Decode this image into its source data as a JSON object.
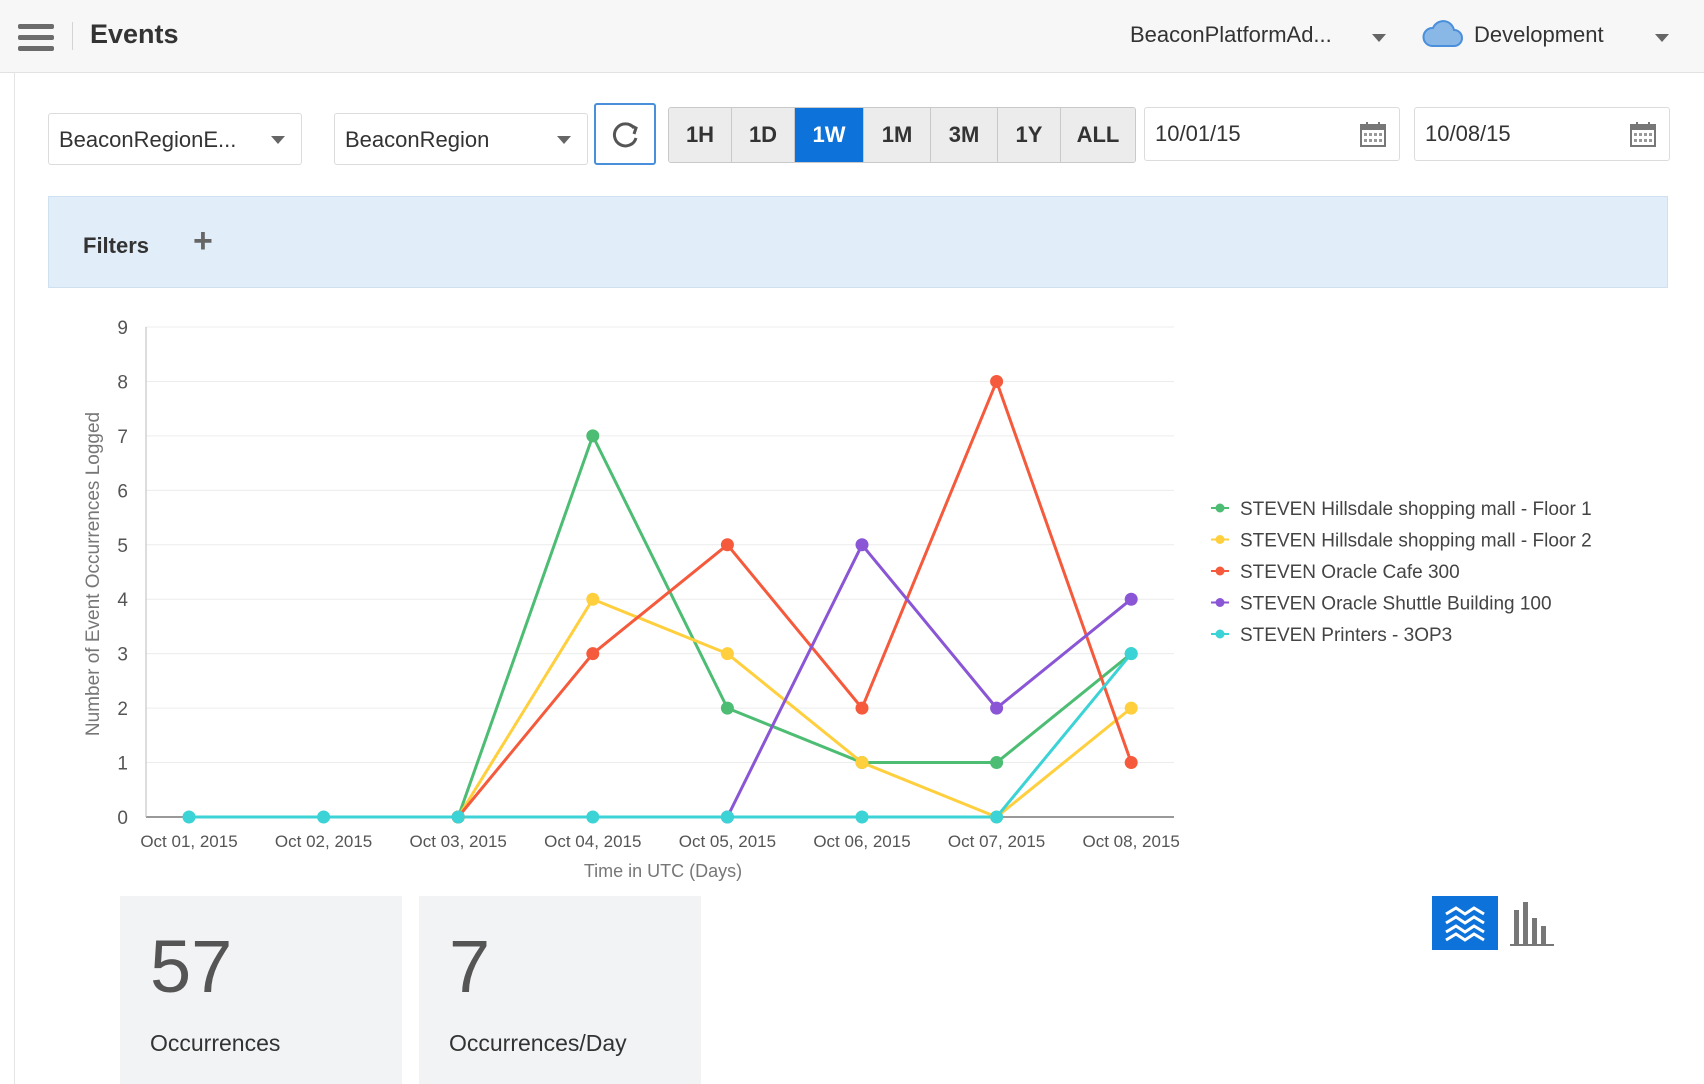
{
  "header": {
    "title": "Events",
    "user_account": "BeaconPlatformAd...",
    "environment": "Development",
    "menu_icon": "hamburger-menu-icon",
    "environment_icon": "cloud-icon"
  },
  "toolbar": {
    "event_select": "BeaconRegionE...",
    "region_select": "BeaconRegion",
    "refresh_icon": "refresh-icon",
    "ranges": [
      "1H",
      "1D",
      "1W",
      "1M",
      "3M",
      "1Y",
      "ALL"
    ],
    "active_range": "1W",
    "start_date": "10/01/15",
    "end_date": "10/08/15",
    "calendar_icon": "calendar-icon",
    "accent_color": "#0d72d9"
  },
  "filters": {
    "label": "Filters",
    "add_symbol": "+"
  },
  "chart_data": {
    "type": "line",
    "xlabel": "Time in UTC (Days)",
    "ylabel": "Number of Event Occurrences Logged",
    "ylim": [
      0,
      9
    ],
    "yticks": [
      0,
      1,
      2,
      3,
      4,
      5,
      6,
      7,
      8,
      9
    ],
    "grid": true,
    "legend_position": "right",
    "categories": [
      "Oct 01, 2015",
      "Oct 02, 2015",
      "Oct 03, 2015",
      "Oct 04, 2015",
      "Oct 05, 2015",
      "Oct 06, 2015",
      "Oct 07, 2015",
      "Oct 08, 2015"
    ],
    "series": [
      {
        "name": "STEVEN Hillsdale shopping mall - Floor 1",
        "color": "#4dbd74",
        "values": [
          null,
          null,
          0,
          7,
          2,
          1,
          1,
          3
        ]
      },
      {
        "name": "STEVEN Hillsdale shopping mall - Floor 2",
        "color": "#ffcf3d",
        "values": [
          null,
          null,
          0,
          4,
          3,
          1,
          0,
          2
        ]
      },
      {
        "name": "STEVEN Oracle Cafe 300",
        "color": "#f55a3c",
        "values": [
          null,
          null,
          0,
          3,
          5,
          2,
          8,
          1
        ]
      },
      {
        "name": "STEVEN Oracle Shuttle Building 100",
        "color": "#8a56d6",
        "values": [
          null,
          null,
          null,
          null,
          0,
          5,
          2,
          4
        ]
      },
      {
        "name": "STEVEN Printers - 3OP3",
        "color": "#3cd3d6",
        "values": [
          0,
          0,
          0,
          0,
          0,
          0,
          0,
          3
        ]
      }
    ]
  },
  "stats": [
    {
      "value": "57",
      "label": "Occurrences"
    },
    {
      "value": "7",
      "label": "Occurrences/Day"
    }
  ],
  "view_toggle": {
    "area_icon": "stacked-area-chart-icon",
    "bar_icon": "bar-chart-icon"
  }
}
